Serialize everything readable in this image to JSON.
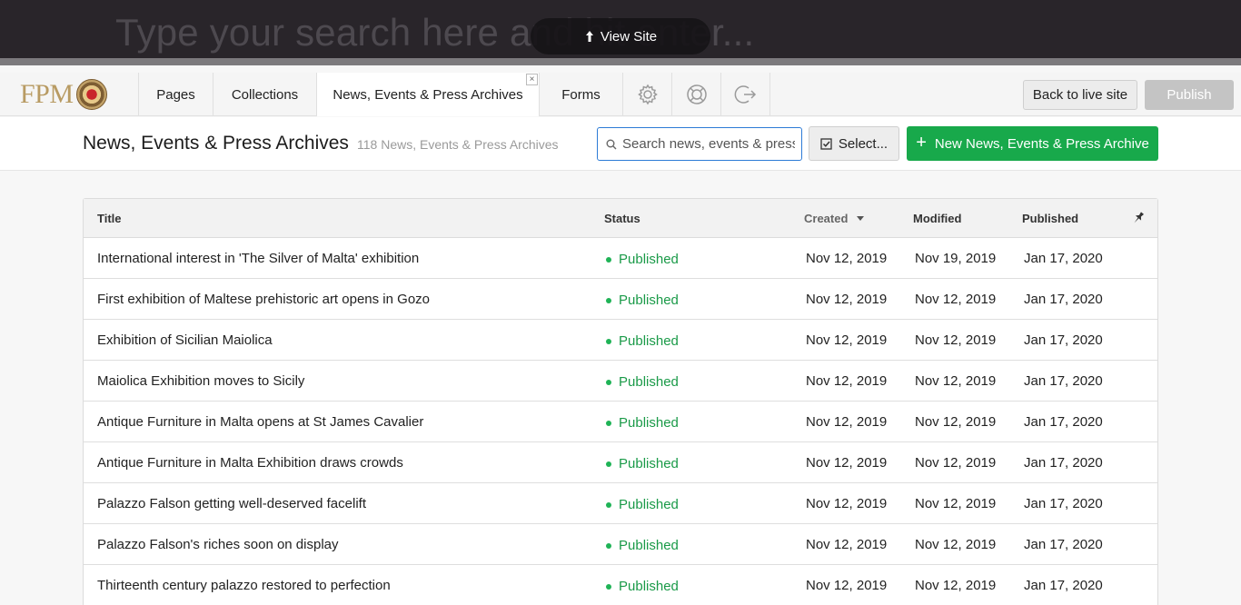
{
  "top_search": {
    "placeholder": "Type your search here and hit enter...",
    "view_site_label": "View Site"
  },
  "nav": {
    "logo_text": "FPM",
    "items": [
      {
        "label": "Pages"
      },
      {
        "label": "Collections"
      },
      {
        "label": "News, Events & Press Archives",
        "active": true
      },
      {
        "label": "Forms"
      }
    ],
    "icons": [
      "gear-icon",
      "lifebuoy-icon",
      "logout-icon"
    ],
    "back_label": "Back to live site",
    "publish_label": "Publish"
  },
  "header": {
    "title": "News, Events & Press Archives",
    "count": "118 News, Events & Press Archives",
    "search_placeholder": "Search news, events & press",
    "select_label": "Select...",
    "new_label": "New News, Events & Press Archive"
  },
  "table": {
    "columns": {
      "title": "Title",
      "status": "Status",
      "created": "Created",
      "modified": "Modified",
      "published": "Published"
    },
    "rows": [
      {
        "title": "International interest in 'The Silver of Malta' exhibition",
        "status": "Published",
        "created": "Nov 12, 2019",
        "modified": "Nov 19, 2019",
        "published": "Jan 17, 2020"
      },
      {
        "title": "First exhibition of Maltese prehistoric art opens in Gozo",
        "status": "Published",
        "created": "Nov 12, 2019",
        "modified": "Nov 12, 2019",
        "published": "Jan 17, 2020"
      },
      {
        "title": "Exhibition of Sicilian Maiolica",
        "status": "Published",
        "created": "Nov 12, 2019",
        "modified": "Nov 12, 2019",
        "published": "Jan 17, 2020"
      },
      {
        "title": "Maiolica Exhibition moves to Sicily",
        "status": "Published",
        "created": "Nov 12, 2019",
        "modified": "Nov 12, 2019",
        "published": "Jan 17, 2020"
      },
      {
        "title": "Antique Furniture in Malta opens at St James Cavalier",
        "status": "Published",
        "created": "Nov 12, 2019",
        "modified": "Nov 12, 2019",
        "published": "Jan 17, 2020"
      },
      {
        "title": "Antique Furniture in Malta Exhibition draws crowds",
        "status": "Published",
        "created": "Nov 12, 2019",
        "modified": "Nov 12, 2019",
        "published": "Jan 17, 2020"
      },
      {
        "title": "Palazzo Falson getting well-deserved facelift",
        "status": "Published",
        "created": "Nov 12, 2019",
        "modified": "Nov 12, 2019",
        "published": "Jan 17, 2020"
      },
      {
        "title": "Palazzo Falson's riches soon on display",
        "status": "Published",
        "created": "Nov 12, 2019",
        "modified": "Nov 12, 2019",
        "published": "Jan 17, 2020"
      },
      {
        "title": "Thirteenth century palazzo restored to perfection",
        "status": "Published",
        "created": "Nov 12, 2019",
        "modified": "Nov 12, 2019",
        "published": "Jan 17, 2020"
      }
    ]
  },
  "colors": {
    "accent_green": "#18a94b",
    "status_green": "#1a9a48",
    "search_border": "#2d7bd6",
    "logo_gold": "#b89b63"
  }
}
